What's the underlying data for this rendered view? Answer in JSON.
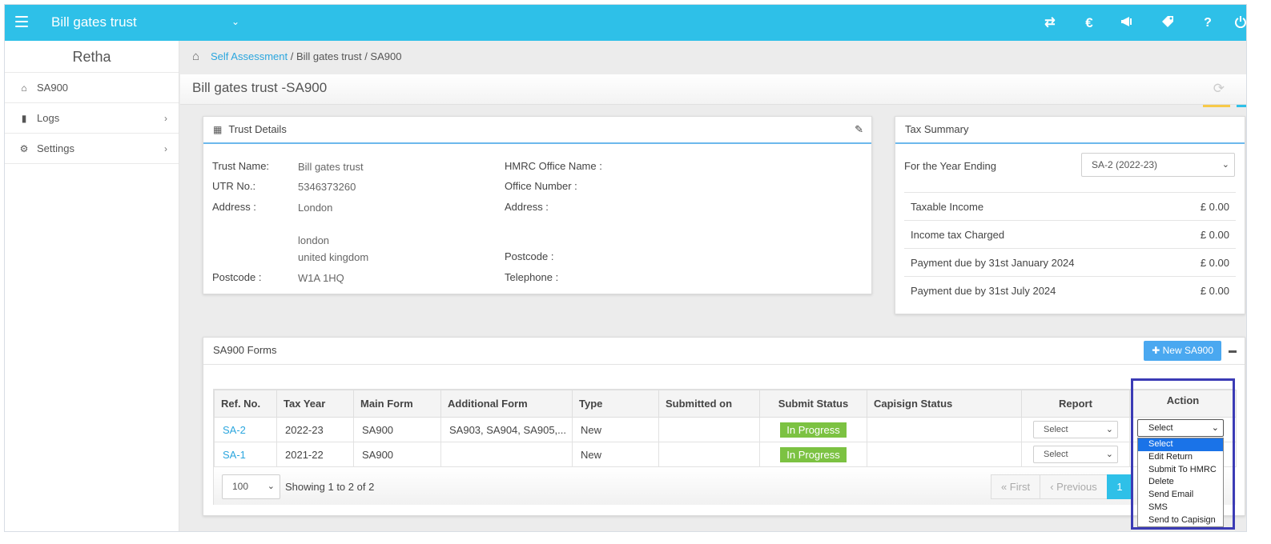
{
  "app": {
    "title": "Bill gates trust"
  },
  "sidebar": {
    "user": "Retha",
    "items": [
      {
        "label": "SA900",
        "icon": "home-icon"
      },
      {
        "label": "Logs",
        "icon": "file-icon"
      },
      {
        "label": "Settings",
        "icon": "gear-icon"
      }
    ]
  },
  "breadcrumb": {
    "link": "Self Assessment",
    "rest": " / Bill gates trust / SA900"
  },
  "page": {
    "title": "Bill gates trust -SA900"
  },
  "trust_details": {
    "heading": "Trust Details",
    "left": {
      "name_label": "Trust Name:",
      "name_value": "Bill gates trust",
      "utr_label": "UTR No.:",
      "utr_value": "5346373260",
      "address_label": "Address :",
      "address_line1": "London",
      "address_line2": "london",
      "address_line3": "united kingdom",
      "postcode_label": "Postcode :",
      "postcode_value": "W1A 1HQ"
    },
    "right": {
      "office_name_label": "HMRC Office Name :",
      "office_number_label": "Office Number :",
      "address_label": "Address :",
      "postcode_label": "Postcode :",
      "telephone_label": "Telephone :"
    }
  },
  "tax_summary": {
    "heading": "Tax Summary",
    "year_label": "For the Year Ending",
    "year_selected": "SA-2 (2022-23)",
    "rows": [
      {
        "label": "Taxable Income",
        "amount": "£ 0.00"
      },
      {
        "label": "Income tax Charged",
        "amount": "£ 0.00"
      },
      {
        "label": "Payment due by 31st January 2024",
        "amount": "£ 0.00"
      },
      {
        "label": "Payment due by 31st July 2024",
        "amount": "£ 0.00"
      }
    ]
  },
  "forms": {
    "heading": "SA900 Forms",
    "new_button": "New SA900",
    "columns": [
      "Ref. No.",
      "Tax Year",
      "Main Form",
      "Additional Form",
      "Type",
      "Submitted on",
      "Submit Status",
      "Capisign Status",
      "Report",
      "Action"
    ],
    "rows": [
      {
        "ref": "SA-2",
        "year": "2022-23",
        "main": "SA900",
        "additional": "SA903, SA904, SA905,...",
        "type": "New",
        "submitted": "",
        "status": "In Progress",
        "capisign": "",
        "report": "Select",
        "action": "Select"
      },
      {
        "ref": "SA-1",
        "year": "2021-22",
        "main": "SA900",
        "additional": "",
        "type": "New",
        "submitted": "",
        "status": "In Progress",
        "capisign": "",
        "report": "Select",
        "action": "Select"
      }
    ],
    "page_size": "100",
    "showing": "Showing 1 to 2 of 2",
    "pager": {
      "first": "« First",
      "previous": "‹ Previous",
      "current": "1"
    }
  },
  "action_dropdown": {
    "selected": "Select",
    "options": [
      "Select",
      "Edit Return",
      "Submit To HMRC",
      "Delete",
      "Send Email",
      "SMS",
      "Send to Capisign"
    ]
  },
  "colors": {
    "accent": "#2ec0e8",
    "status_green": "#7cc242",
    "link": "#2ba6de",
    "button": "#4aa8f0",
    "highlight": "#3b3bb5"
  }
}
